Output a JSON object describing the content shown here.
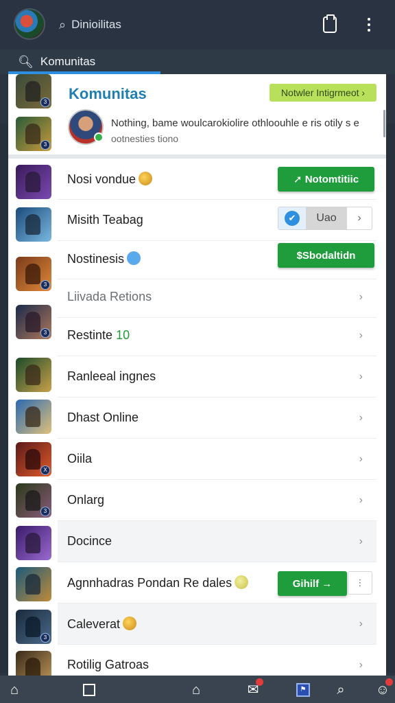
{
  "header": {
    "search_text": "Dinioilitas",
    "search_icon": "search-icon",
    "clipboard_icon": "clipboard-icon",
    "menu_icon": "kebab-menu-icon"
  },
  "subbar": {
    "query": "Komunitas"
  },
  "community": {
    "title": "Komunitas",
    "promo_label": "Notwler Intigrmeot ›",
    "description": "Nothing, bame woulcarokiolire othloouhle e ris otily s e",
    "description_sub": "ootnesties tiono"
  },
  "rows": [
    {
      "label": "Nosi vondue",
      "extra": "coin",
      "button": "➚ Notomtitiic"
    },
    {
      "label": "Misith Teabag",
      "toggle_value": "Uao",
      "toggle_arrow": "›"
    },
    {
      "label": "Nostinesis",
      "extra": "bluedot",
      "button": "$Sbodaltidn"
    },
    {
      "label": "Liivada Retions",
      "muted": true
    },
    {
      "label": "Restinte",
      "number": "10"
    },
    {
      "label": "Ranleeal ingnes"
    },
    {
      "label": "Dhast Online"
    },
    {
      "label": "Oiila"
    },
    {
      "label": "Onlarg"
    },
    {
      "label": "Docince"
    },
    {
      "label": "Agnnhadras Pondan Re dales",
      "extra": "coin",
      "button": "Gihilf →",
      "split": "⋮"
    },
    {
      "label": "Caleverat",
      "extra": "coin"
    },
    {
      "label": "Rotilig Gatroas"
    }
  ],
  "chevron": "›",
  "colors": {
    "accent_blue": "#1f7fb3",
    "green_button": "#1f9d3c",
    "promo_green": "#b8e05b",
    "topbar": "#293341"
  },
  "bottom_nav": [
    "home-icon",
    "square-icon",
    "house-icon",
    "notification-icon",
    "app-icon",
    "search-icon",
    "settings-icon"
  ]
}
